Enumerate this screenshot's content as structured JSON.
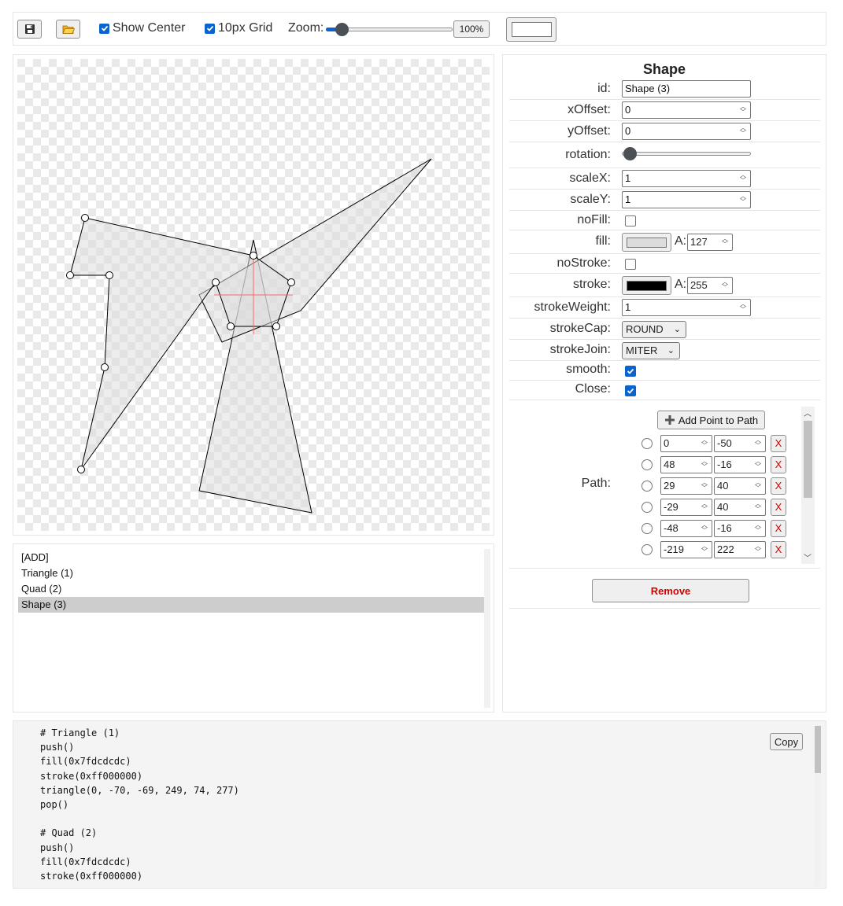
{
  "toolbar": {
    "save_icon": "floppy-disk-icon",
    "open_icon": "folder-open-icon",
    "show_center_label": "Show Center",
    "grid_label": "10px Grid",
    "zoom_label": "Zoom:",
    "zoom_value": "100%",
    "zoom_fraction": 0.08,
    "background_color": "#ffffff"
  },
  "shape_list": {
    "items": [
      {
        "label": "[ADD]"
      },
      {
        "label": "Triangle (1)"
      },
      {
        "label": "Quad (2)"
      },
      {
        "label": "Shape (3)"
      }
    ],
    "selected": "Shape (3)"
  },
  "properties": {
    "title": "Shape",
    "id_label": "id:",
    "id_value": "Shape (3)",
    "xoffset_label": "xOffset:",
    "xoffset_value": "0",
    "yoffset_label": "yOffset:",
    "yoffset_value": "0",
    "rotation_label": "rotation:",
    "rotation_value": 0,
    "scalex_label": "scaleX:",
    "scalex_value": "1",
    "scaley_label": "scaleY:",
    "scaley_value": "1",
    "nofill_label": "noFill:",
    "nofill_checked": false,
    "fill_label": "fill:",
    "fill_color": "#dcdcdc",
    "fill_alpha_label": "A:",
    "fill_alpha": "127",
    "nostroke_label": "noStroke:",
    "nostroke_checked": false,
    "stroke_label": "stroke:",
    "stroke_color": "#000000",
    "stroke_alpha_label": "A:",
    "stroke_alpha": "255",
    "strokeweight_label": "strokeWeight:",
    "strokeweight_value": "1",
    "strokecap_label": "strokeCap:",
    "strokecap_value": "ROUND",
    "strokejoin_label": "strokeJoin:",
    "strokejoin_value": "MITER",
    "smooth_label": "smooth:",
    "smooth_checked": true,
    "close_label": "Close:",
    "close_checked": true,
    "path_label": "Path:",
    "add_point_label": "Add Point to Path",
    "remove_label": "Remove",
    "delete_point_label": "X",
    "path_points": [
      {
        "x": "0",
        "y": "-50"
      },
      {
        "x": "48",
        "y": "-16"
      },
      {
        "x": "29",
        "y": "40"
      },
      {
        "x": "-29",
        "y": "40"
      },
      {
        "x": "-48",
        "y": "-16"
      },
      {
        "x": "-219",
        "y": "222"
      }
    ]
  },
  "code": {
    "copy_label": "Copy",
    "lines": [
      "# Triangle (1)",
      "push()",
      "fill(0x7fdcdcdc)",
      "stroke(0xff000000)",
      "triangle(0, -70, -69, 249, 74, 277)",
      "pop()",
      "",
      "# Quad (2)",
      "push()",
      "fill(0x7fdcdcdc)",
      "stroke(0xff000000)"
    ]
  },
  "canvas": {
    "triangle": [
      [
        0,
        -70
      ],
      [
        -69,
        249
      ],
      [
        74,
        277
      ]
    ],
    "quad": [
      [
        -69,
        0
      ],
      [
        226,
        -173
      ],
      [
        60,
        20
      ],
      [
        -40,
        60
      ]
    ],
    "shape_path": [
      [
        0,
        -50
      ],
      [
        48,
        -16
      ],
      [
        29,
        40
      ],
      [
        -29,
        40
      ],
      [
        -48,
        -16
      ],
      [
        -219,
        222
      ],
      [
        -189,
        92
      ],
      [
        -183,
        -25
      ],
      [
        -233,
        -25
      ],
      [
        -214,
        -98
      ]
    ],
    "fill_color": "#dcdcdc",
    "stroke_color": "#000000",
    "center_line_color": "#ff6666"
  }
}
